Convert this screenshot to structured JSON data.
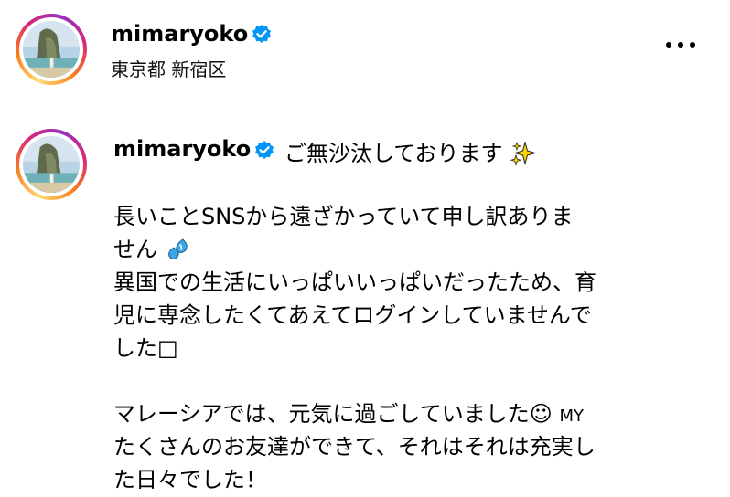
{
  "header": {
    "username": "mimaryoko",
    "location": "東京都 新宿区"
  },
  "post": {
    "username": "mimaryoko",
    "title": "ご無沙汰しております",
    "lines": [
      "長いことSNSから遠ざかっていて申し訳ありま",
      "せん",
      "異国での生活にいっぱいいっぱいだったため、育",
      "児に専念したくてあえてログインしていませんで",
      "した□",
      "マレーシアでは、元気に過ごしていました☺",
      "たくさんのお友達ができて、それはそれは充実し",
      "た日々でした！"
    ],
    "line6_suffix": "MY"
  },
  "icons": {
    "verified": "verified-badge-icon",
    "more": "more-options-icon",
    "sparkles": "sparkles-icon",
    "sweat": "sweat-droplets-icon"
  },
  "colors": {
    "verified": "#0095f6",
    "divider": "#dbdbdb"
  }
}
